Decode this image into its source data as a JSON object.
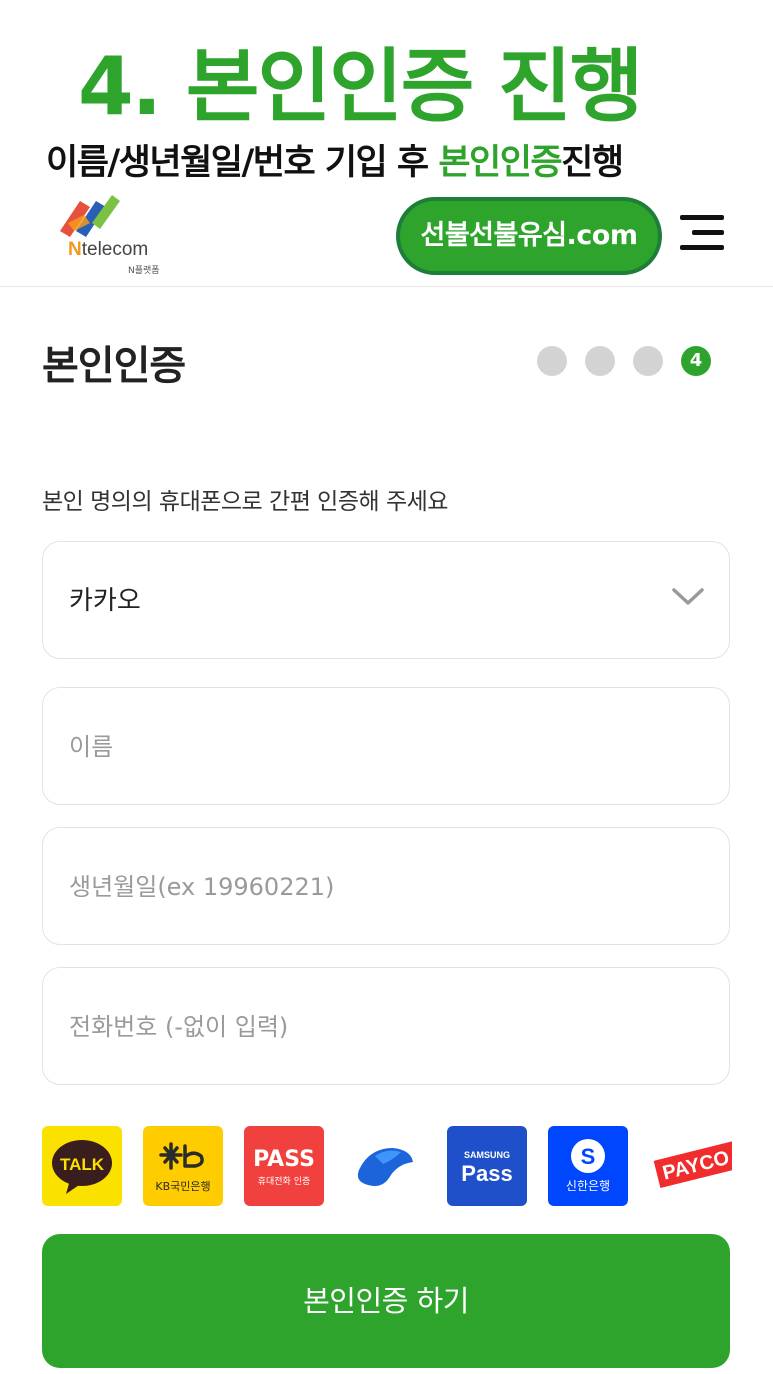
{
  "banner": {
    "title": "4. 본인인증 진행",
    "subtitle_prefix": "이름/생년월일/번호 기입 후 ",
    "subtitle_highlight": "본인인증",
    "subtitle_suffix": "진행"
  },
  "header": {
    "logo_brand_n": "N",
    "logo_brand_rest": "telecom",
    "logo_sub": "N플랫폼",
    "site_badge": "선불선불유심.com",
    "menu_icon": "hamburger-menu-icon"
  },
  "page": {
    "title": "본인인증",
    "steps_total": 4,
    "current_step": "4"
  },
  "form": {
    "instruction": "본인 명의의 휴대폰으로 간편 인증해 주세요",
    "provider_select": {
      "selected": "카카오",
      "icon": "chevron-down-icon"
    },
    "name_placeholder": "이름",
    "birth_placeholder": "생년월일(ex 19960221)",
    "phone_placeholder": "전화번호 (-없이 입력)"
  },
  "auth_providers": [
    {
      "name": "kakao",
      "label": "TALK",
      "color": "#fae100"
    },
    {
      "name": "kb",
      "label": "KB국민은행",
      "color": "#ffcc00"
    },
    {
      "name": "pass",
      "label": "PASS",
      "sublabel": "휴대전화 인증",
      "color": "#f0413f"
    },
    {
      "name": "toss",
      "label": "",
      "color": "#1b64da"
    },
    {
      "name": "samsung-pass",
      "label": "Pass",
      "sublabel": "SAMSUNG",
      "color": "#1f4fc9"
    },
    {
      "name": "shinhan",
      "label": "신한은행",
      "color": "#0046ff"
    },
    {
      "name": "payco",
      "label": "PAYCO",
      "color": "#f02c2c"
    }
  ],
  "submit_label": "본인인증 하기",
  "colors": {
    "accent": "#2ea42c",
    "pill_border": "#1f7d3a",
    "dot_inactive": "#d3d3d3"
  }
}
